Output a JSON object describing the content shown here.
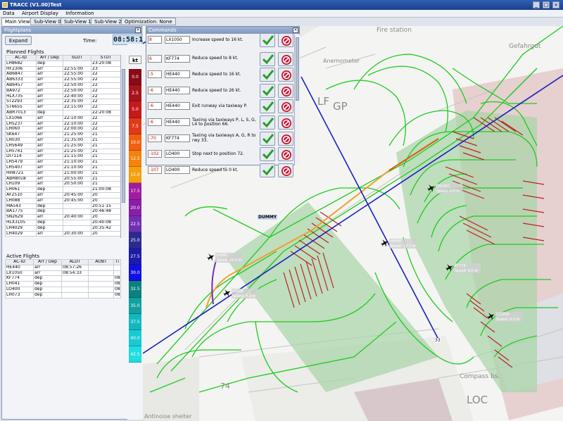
{
  "window": {
    "title": "TRACC (V1.00)Test",
    "min": "_",
    "max": "□",
    "close": "×"
  },
  "menu": [
    "Data",
    "Airport Display",
    "Information"
  ],
  "tabs": [
    "Main View",
    "Sub-View 0",
    "Sub-View 1",
    "Sub-View 2",
    "Optimization: None"
  ],
  "flightplans": {
    "title": "Flightplans",
    "expand": "Expand",
    "time_label": "Time:",
    "time": "08:58:11",
    "planned_title": "Planned Flights",
    "planned_cols": [
      "AC-ID",
      "Arr / Dep",
      "SLDT",
      "STDT"
    ],
    "planned_rows": [
      [
        "LH8682",
        "dep",
        "",
        "23:20:08"
      ],
      [
        "HF2306",
        "arr",
        "22:55:00",
        "23"
      ],
      [
        "AB6847",
        "arr",
        "22:55:00",
        "22"
      ],
      [
        "AB6333",
        "arr",
        "22:55:00",
        "22"
      ],
      [
        "AB6457",
        "arr",
        "22:50:00",
        "22"
      ],
      [
        "BA972",
        "arr",
        "22:50:00",
        "22"
      ],
      [
        "HLX735",
        "arr",
        "22:40:00",
        "22"
      ],
      [
        "ST2293",
        "arr",
        "22:35:00",
        "22"
      ],
      [
        "ST6655",
        "arr",
        "22:15:00",
        "22"
      ],
      [
        "ABR7013",
        "dep",
        "",
        "22:20:08"
      ],
      [
        "LX1066",
        "arr",
        "22:10:00",
        "22"
      ],
      [
        "LH5237",
        "arr",
        "22:10:00",
        "22"
      ],
      [
        "LH060",
        "arr",
        "22:00:00",
        "22"
      ],
      [
        "SK647",
        "arr",
        "21:25:00",
        "21"
      ],
      [
        "LH030",
        "arr",
        "21:35:00",
        "21"
      ],
      [
        "LH5649",
        "arr",
        "21:25:00",
        "21"
      ],
      [
        "LH5741",
        "arr",
        "21:25:00",
        "21"
      ],
      [
        "DI7114",
        "arr",
        "21:15:00",
        "21"
      ],
      [
        "LH5479",
        "arr",
        "21:10:00",
        "21"
      ],
      [
        "LH5407",
        "arr",
        "21:10:00",
        "21"
      ],
      [
        "HH8721",
        "arr",
        "21:00:00",
        "21"
      ],
      [
        "ABR8018",
        "arr",
        "20:55:00",
        "21"
      ],
      [
        "LH109",
        "arr",
        "20:50:00",
        "21"
      ],
      [
        "LH061",
        "dep",
        "",
        "21:00:08"
      ],
      [
        "AF2510",
        "arr",
        "20:45:00",
        "20"
      ],
      [
        "LH088",
        "arr",
        "20:45:00",
        "20"
      ],
      [
        "MA543",
        "dep",
        "",
        "20:51:15"
      ],
      [
        "BA1775",
        "dep",
        "",
        "20:46:48"
      ],
      [
        "SN2629",
        "arr",
        "20:40:00",
        "20"
      ],
      [
        "HLX3105",
        "dep",
        "",
        "20:40:08"
      ],
      [
        "LH4029",
        "dep",
        "",
        "20:35:42"
      ],
      [
        "LH4029",
        "arr",
        "20:30:00",
        "20"
      ]
    ],
    "active_title": "Active Flights",
    "active_cols": [
      "AC-ID",
      "Arr / Dep",
      "ALDT",
      "AOBT",
      "Ti"
    ],
    "active_rows": [
      [
        "HE440",
        "arr",
        "08:57:26",
        "",
        ""
      ],
      [
        "LX1050",
        "arr",
        "08:54:33",
        "",
        ""
      ],
      [
        "KF774",
        "dep",
        "",
        "",
        "08:46"
      ],
      [
        "LH041",
        "dep",
        "",
        "",
        "08:48"
      ],
      [
        "LO400",
        "dep",
        "",
        "",
        "08:50"
      ],
      [
        "LH073",
        "dep",
        "",
        "",
        "08:50"
      ]
    ]
  },
  "speed_scale": {
    "unit": "kt",
    "steps": [
      {
        "label": "0.0",
        "color": "#8a0a16"
      },
      {
        "label": "2.5",
        "color": "#a8141c"
      },
      {
        "label": "5.0",
        "color": "#c41a1c"
      },
      {
        "label": "7.5",
        "color": "#e03a18"
      },
      {
        "label": "10.0",
        "color": "#f06010"
      },
      {
        "label": "12.5",
        "color": "#f5820c"
      },
      {
        "label": "15.0",
        "color": "#f5a00a"
      },
      {
        "label": "17.5",
        "color": "#a01ca0"
      },
      {
        "label": "20.0",
        "color": "#8a1ea8"
      },
      {
        "label": "22.5",
        "color": "#7030b0"
      },
      {
        "label": "25.0",
        "color": "#2a2a90"
      },
      {
        "label": "27.5",
        "color": "#1c1ca8"
      },
      {
        "label": "30.0",
        "color": "#1010e0"
      },
      {
        "label": "32.5",
        "color": "#0a8080"
      },
      {
        "label": "35.0",
        "color": "#10a0a0"
      },
      {
        "label": "37.5",
        "color": "#12b8c0"
      },
      {
        "label": "40.0",
        "color": "#18cad2"
      },
      {
        "label": "42.5",
        "color": "#20dde0"
      }
    ]
  },
  "commands": {
    "title": "Commands",
    "rows": [
      {
        "speed": "8",
        "ac": "LX1050",
        "text": "Increase speed to 16 kt."
      },
      {
        "speed": "6",
        "ac": "KF774",
        "text": "Reduce speed to 8 kt."
      },
      {
        "speed": "-5",
        "ac": "HE440",
        "text": "Reduce speed to 16 kt."
      },
      {
        "speed": "-6",
        "ac": "HE440",
        "text": "Reduce speed to 26 kt."
      },
      {
        "speed": "-6",
        "ac": "HE440",
        "text": "Exit runway via taxiway P."
      },
      {
        "speed": "-6",
        "ac": "HE440",
        "text": "Taxiing via taxiways P, L, S, G, L4 to position 66."
      },
      {
        "speed": "-70",
        "ac": "KF774",
        "text": "Taxiing via taxiways A, G, R to rwy 33."
      },
      {
        "speed": "-102",
        "ac": "LO400",
        "text": "Stop next to position 72."
      },
      {
        "speed": "-107",
        "ac": "LO400",
        "text": "Reduce speed to 0 kt."
      }
    ]
  },
  "map": {
    "labels": [
      "Fire station",
      "Gefahrgut",
      "Anemometer",
      "LF",
      "GP",
      "LOC",
      "Compass bs.",
      "Antinoise shelter",
      "74",
      "33",
      "DUMMY"
    ],
    "aircraft": [
      {
        "id": "LH041",
        "speed": "Speed: 23.4 kt"
      },
      {
        "id": "LO400",
        "speed": "Speed: 0.0 kt"
      },
      {
        "id": "HE440",
        "speed": "Speed: 17.1 kt"
      },
      {
        "id": "KF774",
        "speed": "Speed: 8.0 kt"
      },
      {
        "id": "LX1050",
        "speed": "Speed: 0.0 kt"
      },
      {
        "id": "LH5407",
        "speed": "Speed: 0.0 kt"
      }
    ]
  }
}
